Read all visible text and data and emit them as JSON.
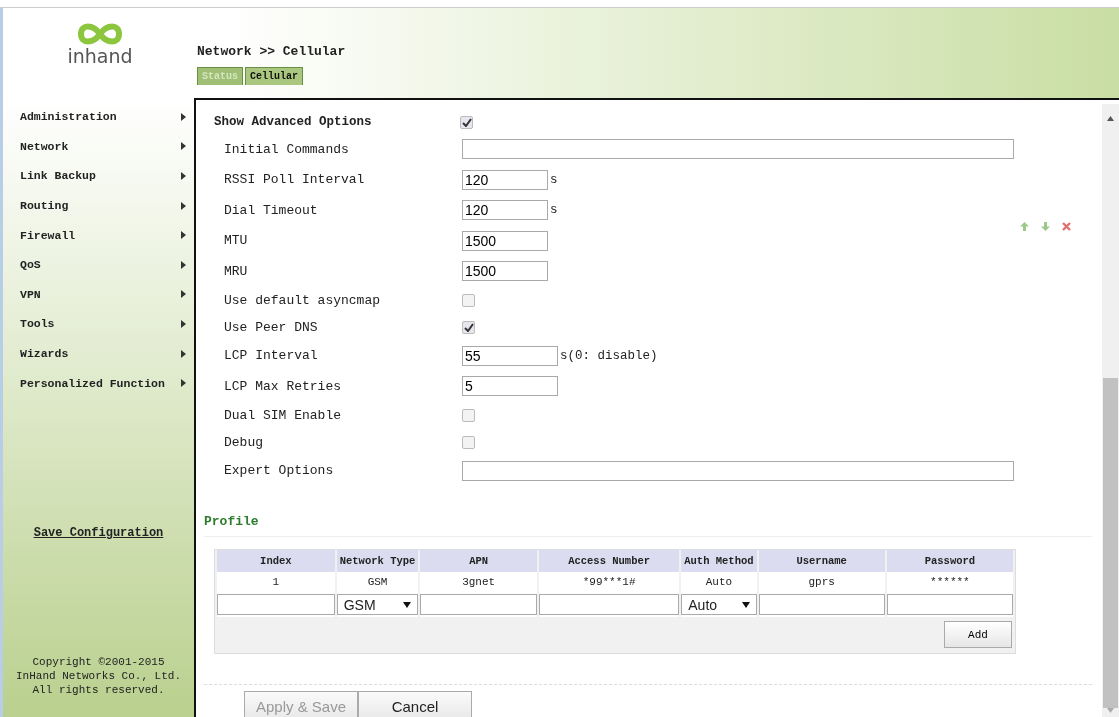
{
  "logo": {
    "text": "inhand"
  },
  "breadcrumb": "Network >> Cellular",
  "tabs": [
    {
      "label": "Status",
      "selected": false
    },
    {
      "label": "Cellular",
      "selected": true
    }
  ],
  "menu": [
    {
      "label": "Administration"
    },
    {
      "label": "Network"
    },
    {
      "label": "Link Backup"
    },
    {
      "label": "Routing"
    },
    {
      "label": "Firewall"
    },
    {
      "label": "QoS"
    },
    {
      "label": "VPN"
    },
    {
      "label": "Tools"
    },
    {
      "label": "Wizards"
    },
    {
      "label": "Personalized Function"
    }
  ],
  "save_link": "Save Configuration",
  "copyright": [
    "Copyright ©2001-2015",
    "InHand Networks Co., Ltd.",
    "All rights reserved."
  ],
  "advanced": {
    "label": "Show Advanced Options",
    "checked": true
  },
  "fields": [
    {
      "kind": "wide",
      "label": "Initial Commands"
    },
    {
      "kind": "short",
      "label": "RSSI Poll Interval",
      "value": "120",
      "unit": "s"
    },
    {
      "kind": "short",
      "label": "Dial Timeout",
      "value": "120",
      "unit": "s"
    },
    {
      "kind": "short",
      "label": "MTU",
      "value": "1500"
    },
    {
      "kind": "short",
      "label": "MRU",
      "value": "1500"
    },
    {
      "kind": "checkbox",
      "label": "Use default asyncmap",
      "checked": false
    },
    {
      "kind": "checkbox",
      "label": "Use Peer DNS",
      "checked": true
    },
    {
      "kind": "medium",
      "label": "LCP Interval",
      "value": "55",
      "unit": "s(0: disable)"
    },
    {
      "kind": "medium",
      "label": "LCP Max Retries",
      "value": "5"
    },
    {
      "kind": "checkbox",
      "label": "Dual SIM Enable",
      "checked": false
    },
    {
      "kind": "checkbox",
      "label": "Debug",
      "checked": false
    },
    {
      "kind": "wide",
      "label": "Expert Options"
    }
  ],
  "profile": {
    "title": "Profile",
    "columns": [
      "Index",
      "Network Type",
      "APN",
      "Access Number",
      "Auth Method",
      "Username",
      "Password"
    ],
    "rows": [
      [
        "1",
        "GSM",
        "3gnet",
        "*99***1#",
        "Auto",
        "gprs",
        "******"
      ]
    ],
    "new_row": {
      "network_type": "GSM",
      "auth_method": "Auto"
    },
    "add_button": "Add"
  },
  "buttons": [
    {
      "label": "Apply & Save",
      "disabled": true
    },
    {
      "label": "Cancel",
      "disabled": false
    }
  ]
}
